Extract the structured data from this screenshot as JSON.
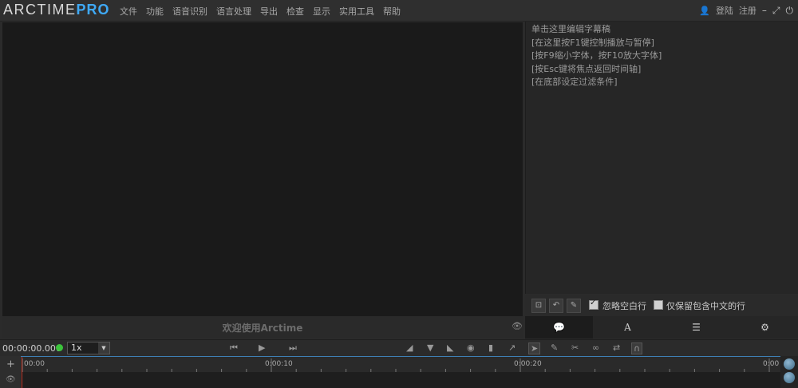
{
  "app": {
    "logo_main": "ARCTIME",
    "logo_pro": "PRO"
  },
  "menu": [
    "文件",
    "功能",
    "语音识别",
    "语言处理",
    "导出",
    "检查",
    "显示",
    "实用工具",
    "帮助"
  ],
  "account": {
    "login": "登陆",
    "register": "注册"
  },
  "video": {
    "welcome": "欢迎使用Arctime"
  },
  "subtitle_panel": {
    "lines": [
      "单击这里编辑字幕稿",
      "[在这里按F1键控制播放与暂停]",
      "[按F9缩小字体，按F10放大字体]",
      "[按Esc键将焦点返回时间轴]",
      "[在底部设定过滤条件]"
    ],
    "ignore_blank": {
      "label": "忽略空白行",
      "checked": true
    },
    "keep_chinese": {
      "label": "仅保留包含中文的行",
      "checked": false
    }
  },
  "tabs": [
    "💬",
    "A",
    "☰",
    "⚙"
  ],
  "transport": {
    "timecode": "00:00:00.000",
    "speed": "1x"
  },
  "timeline": {
    "labels": [
      "00:00",
      "0:00:10",
      "0:00:20",
      "0:00"
    ]
  },
  "colors": {
    "accent": "#3fa9f5",
    "status": "#3cc43c",
    "playhead": "#c0392b"
  },
  "icons": [
    "user-icon",
    "minimize-icon",
    "maximize-icon",
    "power-icon",
    "eye-icon",
    "play-icon",
    "camera-icon",
    "scissors-icon",
    "magnet-icon",
    "gear-icon",
    "list-icon",
    "chat-icon"
  ]
}
